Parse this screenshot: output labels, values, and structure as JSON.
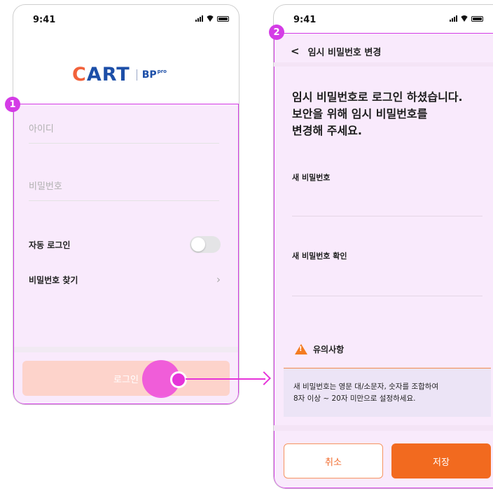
{
  "status_bar": {
    "time": "9:41"
  },
  "login_screen": {
    "logo": {
      "cart": "CART",
      "bp": "BP",
      "pro": "pro"
    },
    "badge": "1",
    "id_placeholder": "아이디",
    "password_placeholder": "비밀번호",
    "auto_login_label": "자동 로그인",
    "auto_login_on": false,
    "find_password_label": "비밀번호 찾기",
    "login_button": "로그인"
  },
  "change_password_screen": {
    "badge": "2",
    "nav_title": "임시 비밀번호 변경",
    "heading_lines": [
      "임시 비밀번호로 로그인 하셨습니다.",
      "보안을 위해 임시 비밀번호를",
      "변경해 주세요."
    ],
    "new_password_label": "새 비밀번호",
    "confirm_password_label": "새 비밀번호 확인",
    "notice_title": "유의사항",
    "notice_lines": [
      "새 비밀번호는 영문 대/소문자, 숫자를 조합하여",
      "8자 이상 ~ 20자 미만으로 설정하세요."
    ],
    "cancel_button": "취소",
    "save_button": "저장"
  },
  "colors": {
    "highlight": "#d43ce6",
    "accent": "#f26a1f",
    "brand_blue": "#1d4fa8"
  },
  "icons": [
    "back-chevron-icon",
    "chevron-right-icon",
    "warning-icon",
    "signal-icon",
    "wifi-icon",
    "battery-icon"
  ]
}
